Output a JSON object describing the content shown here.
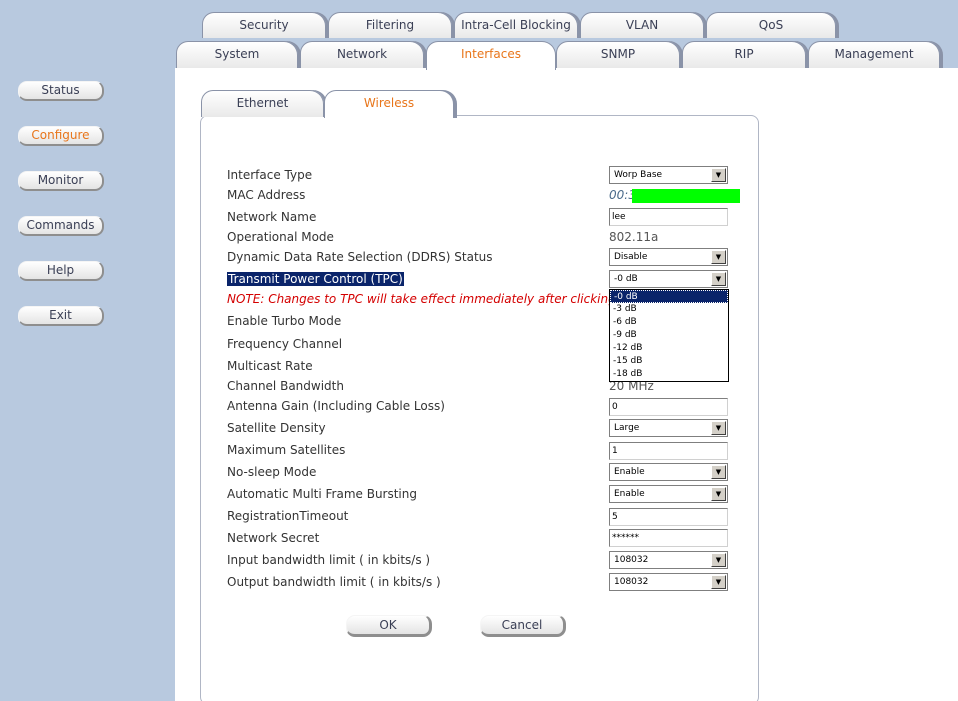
{
  "nav": {
    "status": "Status",
    "configure": "Configure",
    "monitor": "Monitor",
    "commands": "Commands",
    "help": "Help",
    "exit": "Exit"
  },
  "tabs_row1": [
    "Security",
    "Filtering",
    "Intra-Cell Blocking",
    "VLAN",
    "QoS"
  ],
  "tabs_row2": [
    "System",
    "Network",
    "Interfaces",
    "SNMP",
    "RIP",
    "Management"
  ],
  "subtabs": [
    "Ethernet",
    "Wireless"
  ],
  "fields": {
    "interface_type": {
      "label": "Interface Type",
      "value": "Worp Base"
    },
    "mac_address": {
      "label": "MAC Address",
      "value": "00:3"
    },
    "network_name": {
      "label": "Network Name",
      "value": "lee"
    },
    "operational_mode": {
      "label": "Operational Mode",
      "value": "802.11a"
    },
    "ddrs": {
      "label": "Dynamic Data Rate Selection (DDRS) Status",
      "value": "Disable"
    },
    "tpc": {
      "label": "Transmit Power Control (TPC)",
      "value": "-0 dB"
    },
    "note": "NOTE: Changes to TPC will take effect immediately after clicking OK B",
    "turbo": {
      "label": "Enable Turbo Mode"
    },
    "freq": {
      "label": "Frequency Channel"
    },
    "multicast": {
      "label": "Multicast Rate"
    },
    "bandwidth": {
      "label": "Channel Bandwidth",
      "value": "20 MHz"
    },
    "antenna": {
      "label": "Antenna Gain (Including Cable Loss)",
      "value": "0"
    },
    "sat_density": {
      "label": "Satellite Density",
      "value": "Large"
    },
    "max_sat": {
      "label": "Maximum Satellites",
      "value": "1"
    },
    "nosleep": {
      "label": "No-sleep Mode",
      "value": "Enable"
    },
    "ambf": {
      "label": "Automatic Multi Frame Bursting",
      "value": "Enable"
    },
    "regtimeout": {
      "label": "RegistrationTimeout",
      "value": "5"
    },
    "secret": {
      "label": "Network Secret",
      "value": "******"
    },
    "in_bw": {
      "label": "Input bandwidth limit ( in kbits/s )",
      "value": "108032"
    },
    "out_bw": {
      "label": "Output bandwidth limit ( in kbits/s )",
      "value": "108032"
    }
  },
  "tpc_options": [
    "-0 dB",
    "-3 dB",
    "-6 dB",
    "-9 dB",
    "-12 dB",
    "-15 dB",
    "-18 dB"
  ],
  "buttons": {
    "ok": "OK",
    "cancel": "Cancel"
  },
  "colors": {
    "accent": "#e8751a",
    "selection": "#0a246a",
    "note": "#d40000",
    "sidebar": "#b8c9df"
  }
}
